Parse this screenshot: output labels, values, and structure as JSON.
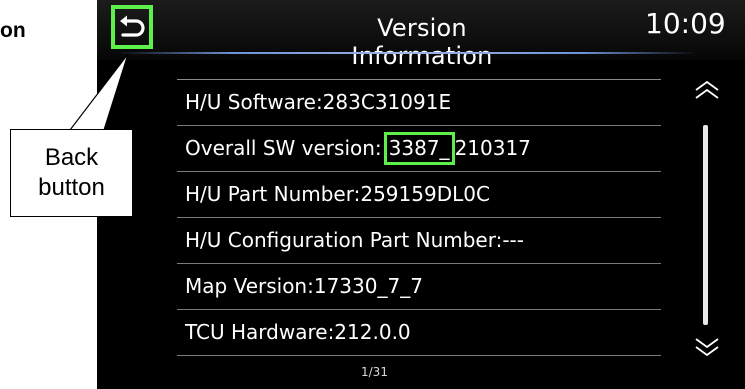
{
  "doc_label": "on",
  "header": {
    "title": "Version Information",
    "clock": "10:09"
  },
  "list": {
    "items": [
      {
        "label": "H/U Software:283C31091E"
      },
      {
        "label_prefix": "Overall SW version:",
        "label_highlight": "3387_",
        "label_suffix": "210317"
      },
      {
        "label": "H/U Part Number:259159DL0C"
      },
      {
        "label": "H/U Configuration Part Number:---"
      },
      {
        "label": "Map Version:17330_7_7"
      },
      {
        "label": "TCU Hardware:212.0.0"
      }
    ]
  },
  "pagination": {
    "text": "1/31"
  },
  "callout": {
    "line1": "Back",
    "line2": "button"
  },
  "colors": {
    "highlight": "#5ef04a",
    "screen_bg": "#000000",
    "header_accent": "#7a9ad8",
    "text": "#ffffff"
  },
  "icons": {
    "back": "back-arrow-icon",
    "up": "double-chevron-up-icon",
    "down": "double-chevron-down-icon"
  }
}
